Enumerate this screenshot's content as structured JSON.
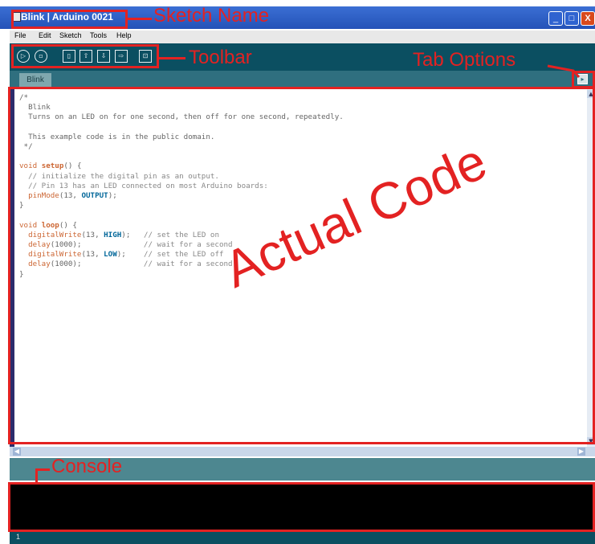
{
  "window": {
    "title": "Blink | Arduino 0021",
    "controls": {
      "minimize": "_",
      "maximize": "□",
      "close": "X"
    }
  },
  "menu": [
    "File",
    "Edit",
    "Sketch",
    "Tools",
    "Help"
  ],
  "toolbar": {
    "buttons": [
      {
        "name": "verify",
        "icon": "play-icon",
        "glyph": "▷"
      },
      {
        "name": "stop",
        "icon": "stop-icon",
        "glyph": "▫"
      },
      {
        "name": "new",
        "icon": "new-icon",
        "glyph": "▯"
      },
      {
        "name": "open",
        "icon": "open-icon",
        "glyph": "⇧"
      },
      {
        "name": "save",
        "icon": "save-icon",
        "glyph": "⇩"
      },
      {
        "name": "upload",
        "icon": "upload-icon",
        "glyph": "⇨"
      },
      {
        "name": "serial-monitor",
        "icon": "serial-monitor-icon",
        "glyph": "⊡"
      }
    ]
  },
  "tabs": [
    {
      "label": "Blink"
    }
  ],
  "tab_menu_glyph": "▸",
  "code_lines": [
    "/*",
    "  Blink",
    "  Turns on an LED on for one second, then off for one second, repeatedly.",
    "",
    "  This example code is in the public domain.",
    " */",
    "",
    "void setup() {",
    "  // initialize the digital pin as an output.",
    "  // Pin 13 has an LED connected on most Arduino boards:",
    "  pinMode(13, OUTPUT);",
    "}",
    "",
    "void loop() {",
    "  digitalWrite(13, HIGH);   // set the LED on",
    "  delay(1000);              // wait for a second",
    "  digitalWrite(13, LOW);    // set the LED off",
    "  delay(1000);              // wait for a second",
    "}"
  ],
  "status": {
    "line_number": "1"
  },
  "annotations": {
    "sketch_name": "Sketch Name",
    "toolbar": "Toolbar",
    "tab_options": "Tab Options",
    "actual_code": "Actual Code",
    "console": "Console"
  },
  "colors": {
    "annotation": "#e32222",
    "toolbar_bg": "#0b4f61",
    "tabbar_bg": "#2f6f7f",
    "keyword": "#cc6633",
    "constant": "#006699"
  }
}
